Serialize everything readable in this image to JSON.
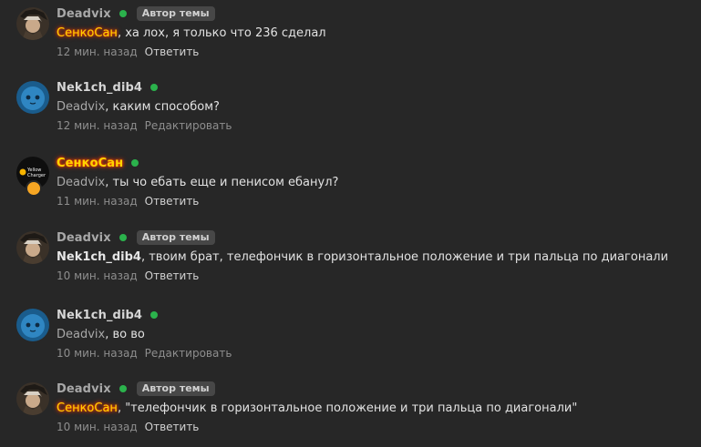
{
  "badges": {
    "author_tag": "Автор темы"
  },
  "comments": [
    {
      "author": "Deadvix",
      "mention": "СенкоСан",
      "text": ", ха лох, я только что 236 сделал",
      "time": "12 мин. назад",
      "action": "Ответить"
    },
    {
      "author": "Nek1ch_dib4",
      "mention": "Deadvix",
      "text": ", каким способом?",
      "time": "12 мин. назад",
      "action": "Редактировать"
    },
    {
      "author": "СенкоСан",
      "mention": "Deadvix",
      "text": ", ты чо ебать еще и пенисом ебанул?",
      "time": "11 мин. назад",
      "action": "Ответить"
    },
    {
      "author": "Deadvix",
      "mention": "Nek1ch_dib4",
      "text": ", твоим брат, телефончик в горизонтальное положение и три пальца по диагонали",
      "time": "10 мин. назад",
      "action": "Ответить"
    },
    {
      "author": "Nek1ch_dib4",
      "mention": "Deadvix",
      "text": ", во во",
      "time": "10 мин. назад",
      "action": "Редактировать"
    },
    {
      "author": "Deadvix",
      "mention": "СенкоСан",
      "text": ", \"телефончик в горизонтальное положение и три пальца по диагонали\"",
      "time": "10 мин. назад",
      "action": "Ответить"
    }
  ],
  "avatar_logo": {
    "line1": "Yellow",
    "line2": "Charger"
  },
  "colors": {
    "background": "#272727",
    "online": "#2bb24c",
    "highlight_name": "#ffd400",
    "highlight_glow": "#ff3b00"
  }
}
